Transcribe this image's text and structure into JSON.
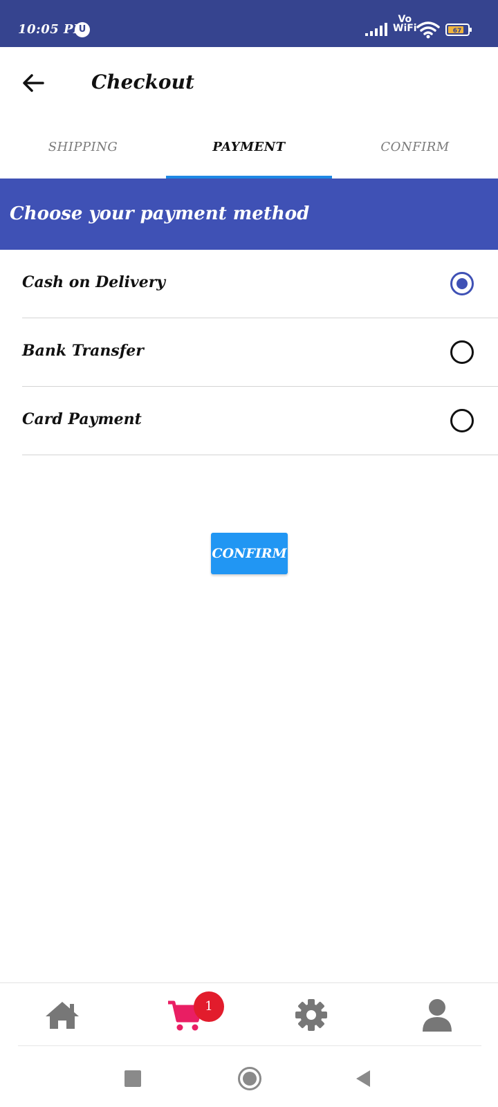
{
  "status_bar": {
    "time": "10:05 PM",
    "app_icon_glyph": "U",
    "network_label": "Vo WiFi",
    "network_top": "Vo",
    "network_bottom": "WiFi",
    "battery_level": "67",
    "background_color": "#36448f"
  },
  "app_bar": {
    "title": "Checkout",
    "back_icon": "arrow-left-icon"
  },
  "tabs": {
    "items": [
      {
        "label": "SHIPPING",
        "active": false
      },
      {
        "label": "PAYMENT",
        "active": true
      },
      {
        "label": "CONFIRM",
        "active": false
      }
    ],
    "indicator_color": "#1e88e5"
  },
  "section": {
    "title": "Choose your payment method",
    "background_color": "#3f51b5"
  },
  "payment_options": [
    {
      "label": "Cash on Delivery",
      "selected": true
    },
    {
      "label": "Bank Transfer",
      "selected": false
    },
    {
      "label": "Card Payment",
      "selected": false
    }
  ],
  "confirm_button": {
    "label": "CONFIRM",
    "color": "#2196f3"
  },
  "bottom_nav": {
    "items": [
      {
        "name": "home",
        "icon": "home-icon",
        "active": false
      },
      {
        "name": "cart",
        "icon": "cart-icon",
        "active": true
      },
      {
        "name": "settings",
        "icon": "gear-icon",
        "active": false
      },
      {
        "name": "profile",
        "icon": "user-icon",
        "active": false
      }
    ],
    "cart_badge": "1",
    "active_color": "#e91e63",
    "inactive_color": "#777777"
  },
  "system_nav": {
    "icons": [
      "recent-apps-icon",
      "home-circle-icon",
      "back-triangle-icon"
    ]
  }
}
